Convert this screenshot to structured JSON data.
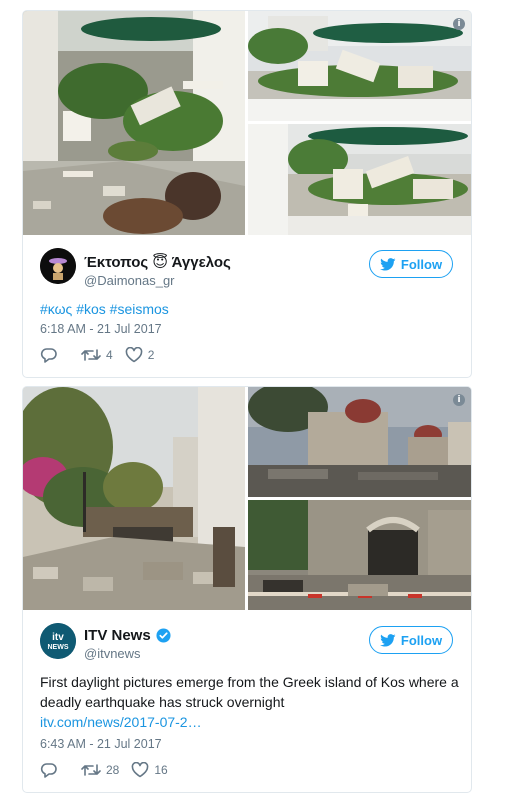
{
  "tweets": [
    {
      "author": {
        "name_part1": "Έκτοπος",
        "emoji": "😇",
        "name_part2": "Άγγελος",
        "handle": "@Daimonas_gr"
      },
      "follow_label": "Follow",
      "text": "#κως #kos #seismos",
      "hashtags": [
        "#κως",
        "#kos",
        "#seismos"
      ],
      "timestamp": "6:18 AM - 21 Jul 2017",
      "replies": "",
      "retweets": "4",
      "likes": "2"
    },
    {
      "author": {
        "name": "ITV News",
        "verified": true,
        "handle": "@itvnews",
        "avatar_text_top": "itv",
        "avatar_text_bottom": "NEWS"
      },
      "follow_label": "Follow",
      "text": "First daylight pictures emerge from the Greek island of Kos where a deadly earthquake has struck overnight",
      "link": "itv.com/news/2017-07-2…",
      "timestamp": "6:43 AM - 21 Jul 2017",
      "replies": "",
      "retweets": "28",
      "likes": "16"
    }
  ],
  "info_icon": "info-icon",
  "colors": {
    "accent": "#1da1f2",
    "link": "#1b95e0",
    "muted": "#657786",
    "border": "#e1e8ed"
  }
}
